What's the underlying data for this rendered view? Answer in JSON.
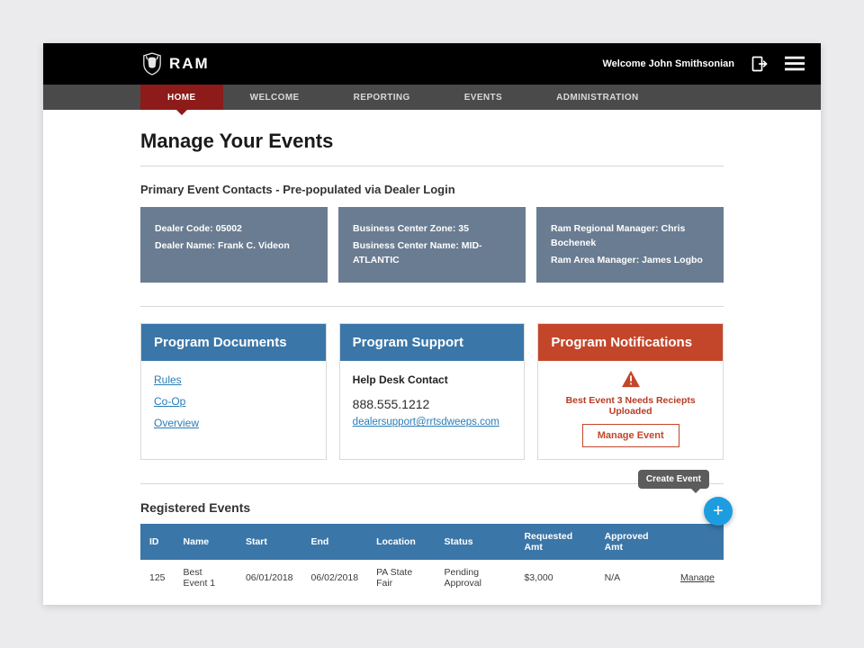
{
  "brand": {
    "name": "RAM"
  },
  "topbar": {
    "welcome_prefix": "Welcome",
    "user_name": "John Smithsonian"
  },
  "nav": {
    "items": [
      {
        "label": "HOME",
        "active": true
      },
      {
        "label": "WELCOME",
        "active": false
      },
      {
        "label": "REPORTING",
        "active": false
      },
      {
        "label": "EVENTS",
        "active": false
      },
      {
        "label": "ADMINISTRATION",
        "active": false
      }
    ]
  },
  "page": {
    "title": "Manage Your Events",
    "contacts_heading": "Primary Event Contacts - Pre-populated via Dealer Login"
  },
  "contacts": [
    [
      "Dealer Code: 05002",
      "Dealer Name: Frank C. Videon"
    ],
    [
      "Business Center Zone: 35",
      "Business Center Name: MID-ATLANTIC"
    ],
    [
      "Ram Regional Manager: Chris Bochenek",
      "Ram Area Manager: James Logbo"
    ]
  ],
  "program_docs": {
    "title": "Program Documents",
    "links": [
      "Rules",
      "Co-Op",
      "Overview"
    ]
  },
  "program_support": {
    "title": "Program Support",
    "contact_label": "Help Desk Contact",
    "phone": "888.555.1212",
    "email": "dealersupport@rrtsdweeps.com"
  },
  "program_notifications": {
    "title": "Program Notifications",
    "message": "Best Event 3 Needs Reciepts Uploaded",
    "button": "Manage Event"
  },
  "registered": {
    "title": "Registered Events",
    "fab_tooltip": "Create Event",
    "columns": [
      "ID",
      "Name",
      "Start",
      "End",
      "Location",
      "Status",
      "Requested Amt",
      "Approved Amt",
      ""
    ],
    "rows": [
      {
        "id": "125",
        "name": "Best Event 1",
        "start": "06/01/2018",
        "end": "06/02/2018",
        "location": "PA State Fair",
        "status": "Pending Approval",
        "requested": "$3,000",
        "approved": "N/A",
        "action": "Manage"
      }
    ]
  }
}
